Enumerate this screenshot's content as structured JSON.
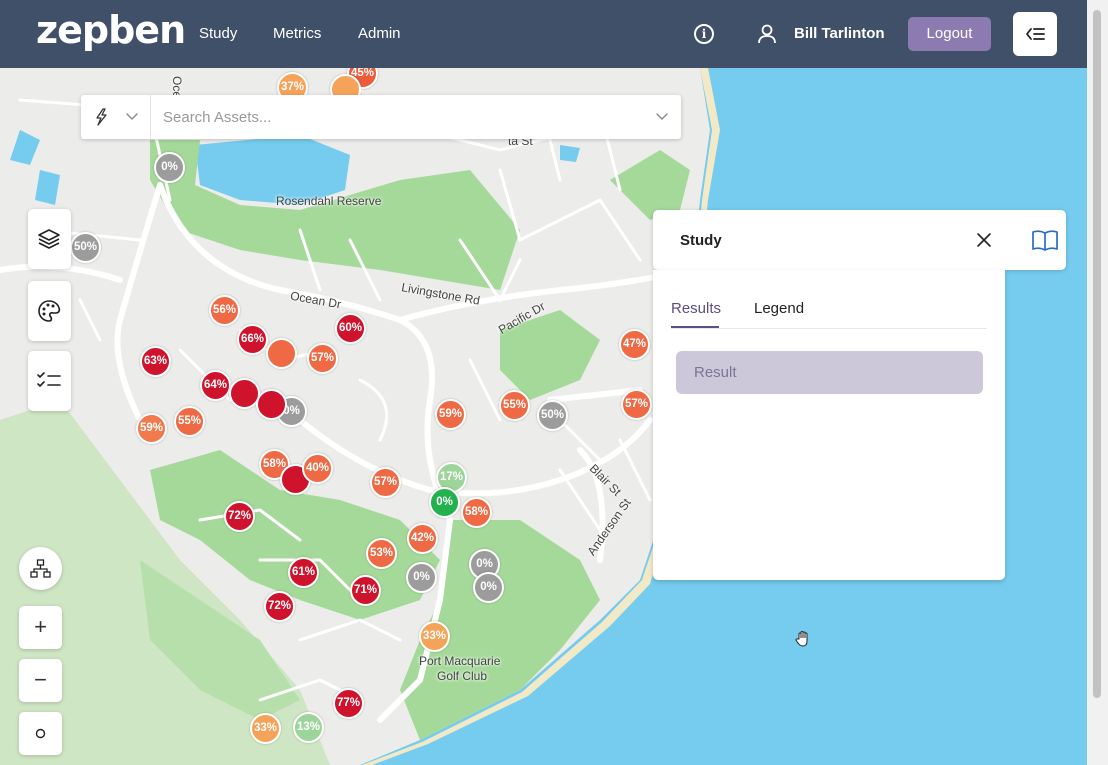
{
  "app": {
    "logo": "zepben",
    "nav": [
      "Study",
      "Metrics",
      "Admin"
    ],
    "user_name": "Bill Tarlinton",
    "logout_label": "Logout"
  },
  "search": {
    "placeholder": "Search Assets..."
  },
  "study_panel": {
    "title": "Study",
    "tabs": [
      {
        "label": "Results",
        "active": true
      },
      {
        "label": "Legend",
        "active": false
      }
    ],
    "result_button": "Result"
  },
  "map": {
    "place_labels": [
      "Rosendahl Reserve",
      "Ocean Dr",
      "Livingstone Rd",
      "Pacific Dr",
      "Blair St",
      "Anderson St",
      "Port Macquarie",
      "Golf Club",
      "Oce",
      "ta St"
    ],
    "markers": [
      {
        "label": "37%",
        "color": "#f6a35a"
      },
      {
        "label": "45%",
        "color": "#ee5a3a"
      },
      {
        "label": "0%",
        "color": "#9c9c9c"
      },
      {
        "label": "50%",
        "color": "#9c9c9c"
      },
      {
        "label": "56%",
        "color": "#ef6a44"
      },
      {
        "label": "66%",
        "color": "#d0132d"
      },
      {
        "label": "60%",
        "color": "#d0132d"
      },
      {
        "label": "57%",
        "color": "#ef6a44"
      },
      {
        "label": "63%",
        "color": "#d0132d"
      },
      {
        "label": "64%",
        "color": "#d0132d"
      },
      {
        "label": "59%",
        "color": "#f07a4c"
      },
      {
        "label": "55%",
        "color": "#ef6a44"
      },
      {
        "label": "0%",
        "color": "#9c9c9c"
      },
      {
        "label": "58%",
        "color": "#ef6a44"
      },
      {
        "label": "40%",
        "color": "#ef6a44"
      },
      {
        "label": "57%",
        "color": "#ef6a44"
      },
      {
        "label": "72%",
        "color": "#d0132d"
      },
      {
        "label": "59%",
        "color": "#ef6a44"
      },
      {
        "label": "55%",
        "color": "#ef6a44"
      },
      {
        "label": "50%",
        "color": "#9c9c9c"
      },
      {
        "label": "17%",
        "color": "#9dd49a"
      },
      {
        "label": "0%",
        "color": "#22b14c"
      },
      {
        "label": "58%",
        "color": "#ef6a44"
      },
      {
        "label": "42%",
        "color": "#ef6a44"
      },
      {
        "label": "53%",
        "color": "#ef6a44"
      },
      {
        "label": "61%",
        "color": "#d0132d"
      },
      {
        "label": "0%",
        "color": "#9c9c9c"
      },
      {
        "label": "0%",
        "color": "#9c9c9c"
      },
      {
        "label": "0%",
        "color": "#9c9c9c"
      },
      {
        "label": "71%",
        "color": "#d0132d"
      },
      {
        "label": "72%",
        "color": "#d0132d"
      },
      {
        "label": "33%",
        "color": "#f6a35a"
      },
      {
        "label": "77%",
        "color": "#d0132d"
      },
      {
        "label": "33%",
        "color": "#f6a35a"
      },
      {
        "label": "13%",
        "color": "#9dd49a"
      },
      {
        "label": "47%",
        "color": "#ef6a44"
      },
      {
        "label": "57%",
        "color": "#ef6a44"
      },
      {
        "label": "",
        "color": "#ef6a44"
      },
      {
        "label": "",
        "color": "#d0132d"
      },
      {
        "label": "",
        "color": "#d0132d"
      },
      {
        "label": "",
        "color": "#d0132d"
      },
      {
        "label": "",
        "color": "#f6a35a"
      }
    ]
  },
  "map_controls": [
    "layers-icon",
    "palette-icon",
    "checklist-icon",
    "network-icon",
    "zoom-in",
    "zoom-out",
    "recenter"
  ],
  "colors": {
    "header": "#3f5068",
    "accent": "#8c7bb0",
    "water": "#75ccef",
    "park": "#a5d99a"
  }
}
